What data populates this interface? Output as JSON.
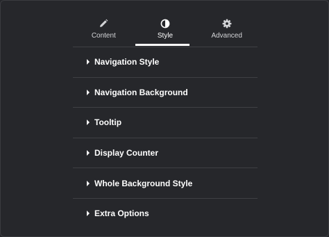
{
  "tabs": [
    {
      "label": "Content",
      "icon": "pencil-icon",
      "active": false
    },
    {
      "label": "Style",
      "icon": "half-circle-icon",
      "active": true
    },
    {
      "label": "Advanced",
      "icon": "gear-icon",
      "active": false
    }
  ],
  "sections": [
    {
      "title": "Navigation Style"
    },
    {
      "title": "Navigation Background"
    },
    {
      "title": "Tooltip"
    },
    {
      "title": "Display Counter"
    },
    {
      "title": "Whole Background Style"
    },
    {
      "title": "Extra Options"
    }
  ],
  "colors": {
    "background": "#26272b",
    "divider": "#3f4044",
    "text": "#ffffff",
    "muted_text": "#d3d4d7"
  }
}
